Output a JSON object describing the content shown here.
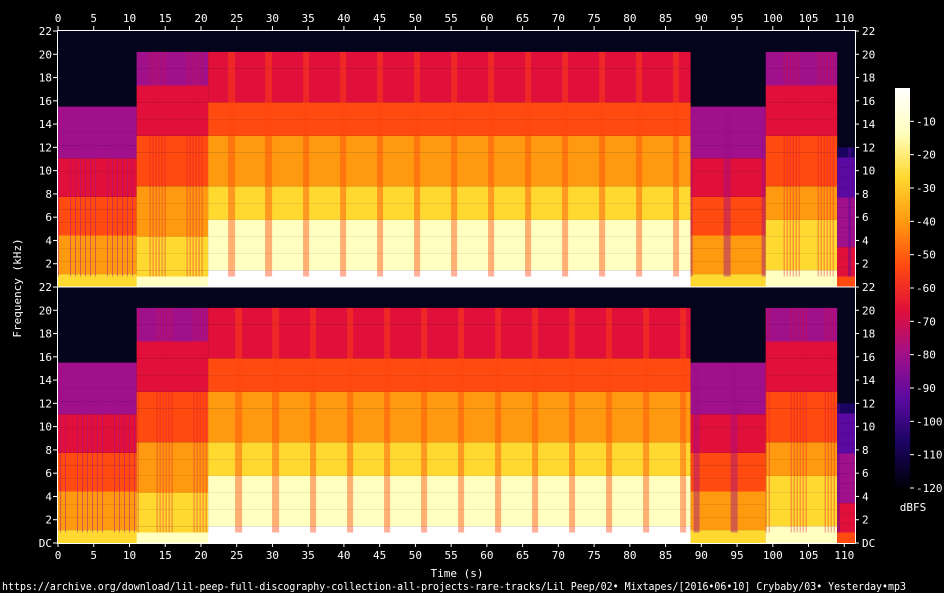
{
  "chart_data": {
    "type": "heatmap",
    "title": "",
    "xlabel": "Time (s)",
    "ylabel": "Frequency (kHz)",
    "xlim": [
      0,
      111.5
    ],
    "ylim_khz": [
      0,
      22
    ],
    "x_ticks": [
      0,
      5,
      10,
      15,
      20,
      25,
      30,
      35,
      40,
      45,
      50,
      55,
      60,
      65,
      70,
      75,
      80,
      85,
      90,
      95,
      100,
      105,
      110
    ],
    "y_ticks_top": [
      "22",
      "20",
      "18",
      "16",
      "14",
      "12",
      "10",
      "8",
      "6",
      "4",
      "2"
    ],
    "y_ticks_bottom": [
      "22",
      "20",
      "18",
      "16",
      "14",
      "12",
      "10",
      "8",
      "6",
      "4",
      "2",
      "DC"
    ],
    "channels": [
      "channel-1",
      "channel-2"
    ],
    "colorbar": {
      "label": "dBFS",
      "ticks": [
        -10,
        -20,
        -30,
        -40,
        -50,
        -60,
        -70,
        -80,
        -90,
        -100,
        -110,
        -120
      ],
      "range": [
        -120,
        0
      ],
      "colors": [
        "#000008",
        "#1a0460",
        "#5a0aa0",
        "#a0108a",
        "#e0103a",
        "#ff4a10",
        "#ff9a10",
        "#ffd830",
        "#ffffc0",
        "#ffffff"
      ]
    },
    "sections": [
      {
        "start": 0,
        "end": 11,
        "cutoff_khz": 15.5,
        "level": 0.55
      },
      {
        "start": 11,
        "end": 21,
        "cutoff_khz": 20.2,
        "level": 0.62
      },
      {
        "start": 21,
        "end": 88.5,
        "cutoff_khz": 20.2,
        "level": 0.8
      },
      {
        "start": 88.5,
        "end": 99,
        "cutoff_khz": 15.5,
        "level": 0.55
      },
      {
        "start": 99,
        "end": 109,
        "cutoff_khz": 20.2,
        "level": 0.66
      },
      {
        "start": 109,
        "end": 111.5,
        "cutoff_khz": 12.0,
        "level": 0.3
      }
    ]
  },
  "footer": {
    "source_path": "https://archive.org/download/lil-peep-full-discography-collection-all-projects-rare-tracks/Lil Peep/02• Mixtapes/[2016•06•10] Crybaby/03• Yesterday•mp3"
  }
}
